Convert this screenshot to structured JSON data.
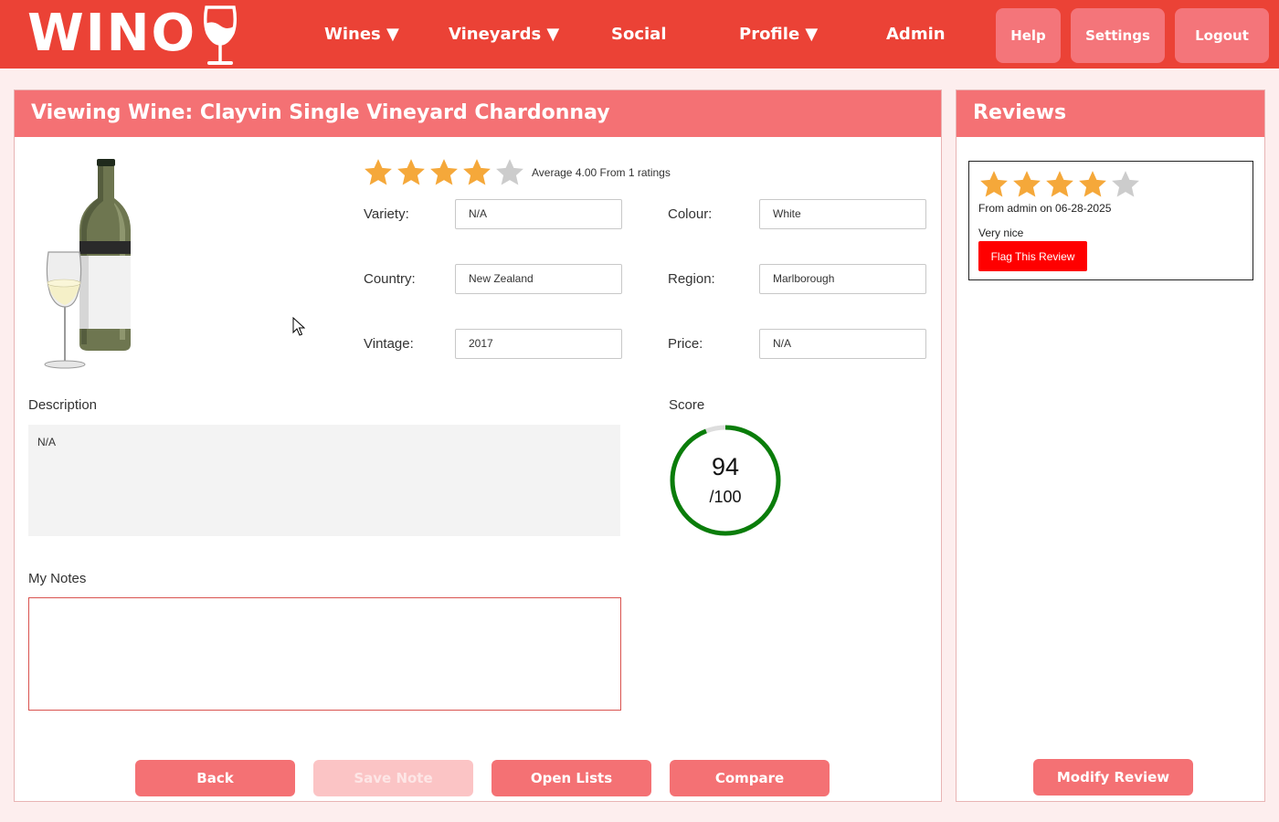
{
  "nav": {
    "logo_text": "WINO",
    "items": [
      {
        "label": "Wines ▼"
      },
      {
        "label": "Vineyards ▼"
      },
      {
        "label": "Social"
      },
      {
        "label": "Profile ▼"
      },
      {
        "label": "Admin"
      }
    ],
    "buttons": {
      "help": "Help",
      "settings": "Settings",
      "logout": "Logout"
    }
  },
  "wine": {
    "title": "Viewing Wine: Clayvin Single Vineyard Chardonnay",
    "rating": {
      "stars_filled": 4,
      "stars_total": 5,
      "text": "Average 4.00 From 1 ratings"
    },
    "fields": {
      "variety_label": "Variety:",
      "variety_value": "N/A",
      "colour_label": "Colour:",
      "colour_value": "White",
      "country_label": "Country:",
      "country_value": "New Zealand",
      "region_label": "Region:",
      "region_value": "Marlborough",
      "vintage_label": "Vintage:",
      "vintage_value": "2017",
      "price_label": "Price:",
      "price_value": "N/A"
    },
    "description_label": "Description",
    "description_value": "N/A",
    "score_label": "Score",
    "score_value": "94",
    "score_max": "/100",
    "notes_label": "My Notes",
    "notes_value": ""
  },
  "actions": {
    "back": "Back",
    "save_note": "Save Note",
    "open_lists": "Open Lists",
    "compare": "Compare"
  },
  "reviews": {
    "title": "Reviews",
    "items": [
      {
        "stars_filled": 4,
        "meta": "From admin on 06-28-2025",
        "text": "Very nice",
        "flag_label": "Flag This Review"
      }
    ],
    "modify_label": "Modify Review"
  },
  "colors": {
    "nav_bg": "#eb4236",
    "header_bg": "#f47174",
    "star_filled": "#f5a83a",
    "star_empty": "#cccccc",
    "score_ring": "#0a7d0a",
    "flag_bg": "#ff0000"
  }
}
